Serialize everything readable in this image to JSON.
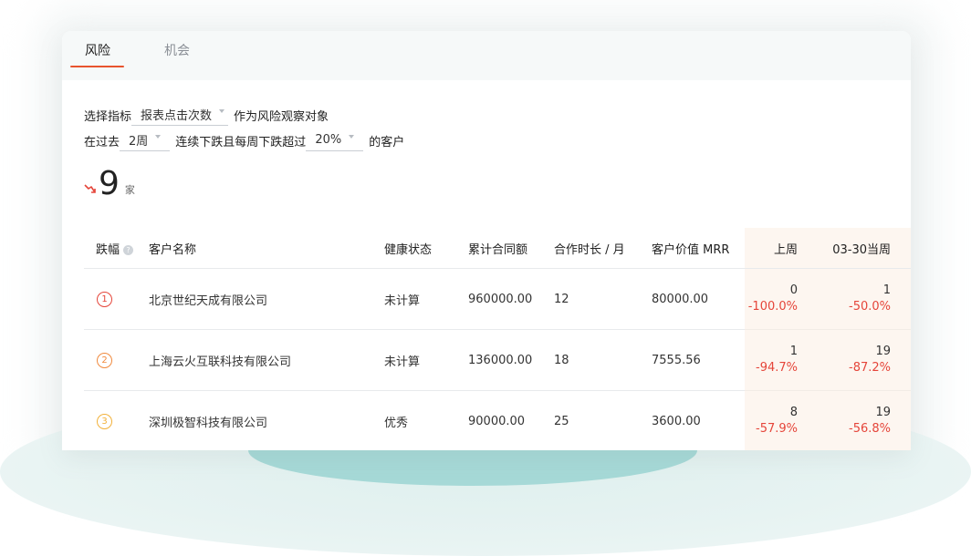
{
  "tabs": [
    {
      "label": "风险",
      "active": true
    },
    {
      "label": "机会",
      "active": false
    }
  ],
  "controls": {
    "row1": {
      "prefix": "选择指标",
      "metric": "报表点击次数",
      "suffix": "作为风险观察对象"
    },
    "row2": {
      "prefix": "在过去",
      "period": "2周",
      "middle": "连续下跌且每周下跌超过",
      "threshold": "20%",
      "suffix": "的客户"
    }
  },
  "summary": {
    "count": "9",
    "unit": "家",
    "trend_icon": "trend-down-icon",
    "trend_color": "#e5453a"
  },
  "table": {
    "headers": {
      "rank": "跌幅",
      "name": "客户名称",
      "health": "健康状态",
      "contract": "累计合同额",
      "duration": "合作时长 / 月",
      "mrr": "客户价值 MRR",
      "last_week": "上周",
      "this_week": "03-30当周"
    },
    "rows": [
      {
        "rank": "1",
        "rank_color": "#e5453a",
        "name": "北京世纪天成有限公司",
        "health": "未计算",
        "contract": "960000.00",
        "duration": "12",
        "mrr": "80000.00",
        "last_week_value": "0",
        "last_week_pct": "-100.0%",
        "this_week_value": "1",
        "this_week_pct": "-50.0%"
      },
      {
        "rank": "2",
        "rank_color": "#f08a3e",
        "name": "上海云火互联科技有限公司",
        "health": "未计算",
        "contract": "136000.00",
        "duration": "18",
        "mrr": "7555.56",
        "last_week_value": "1",
        "last_week_pct": "-94.7%",
        "this_week_value": "19",
        "this_week_pct": "-87.2%"
      },
      {
        "rank": "3",
        "rank_color": "#f2b13a",
        "name": "深圳极智科技有限公司",
        "health": "优秀",
        "contract": "90000.00",
        "duration": "25",
        "mrr": "3600.00",
        "last_week_value": "8",
        "last_week_pct": "-57.9%",
        "this_week_value": "19",
        "this_week_pct": "-56.8%"
      }
    ]
  },
  "colors": {
    "accent": "#e8542e",
    "negative": "#e5453a",
    "teal": "#a6d9d7"
  }
}
